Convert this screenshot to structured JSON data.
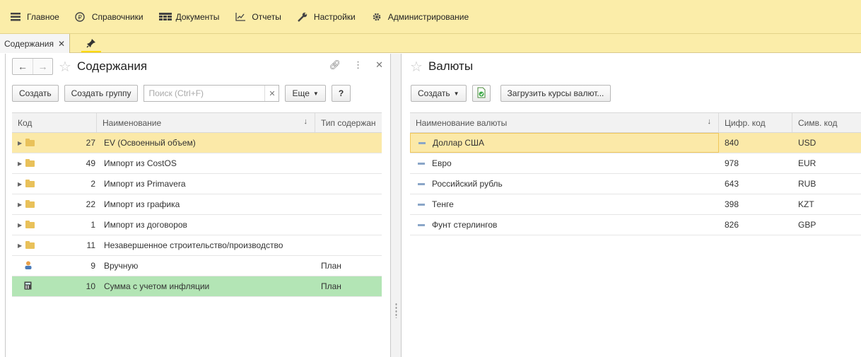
{
  "menu": [
    {
      "icon": "hamburger-icon",
      "label": "Главное"
    },
    {
      "icon": "ruble-icon",
      "label": "Справочники"
    },
    {
      "icon": "table-icon",
      "label": "Документы"
    },
    {
      "icon": "chart-icon",
      "label": "Отчеты"
    },
    {
      "icon": "wrench-icon",
      "label": "Настройки"
    },
    {
      "icon": "gear-icon",
      "label": "Администрирование"
    }
  ],
  "open_tab": {
    "label": "Содержания"
  },
  "left": {
    "title": "Содержания",
    "toolbar": {
      "create": "Создать",
      "create_group": "Создать группу",
      "search_placeholder": "Поиск (Ctrl+F)",
      "more": "Еще",
      "help": "?"
    },
    "columns": [
      "Код",
      "Наименование",
      "Тип содержан"
    ],
    "rows": [
      {
        "code": "27",
        "name": "EV (Освоенный объем)",
        "type": "",
        "kind": "folder"
      },
      {
        "code": "49",
        "name": "Импорт из CostOS",
        "type": "",
        "kind": "folder"
      },
      {
        "code": "2",
        "name": "Импорт из Primavera",
        "type": "",
        "kind": "folder"
      },
      {
        "code": "22",
        "name": "Импорт из графика",
        "type": "",
        "kind": "folder"
      },
      {
        "code": "1",
        "name": "Импорт из договоров",
        "type": "",
        "kind": "folder"
      },
      {
        "code": "11",
        "name": "Незавершенное строительство/производство",
        "type": "",
        "kind": "folder"
      },
      {
        "code": "9",
        "name": "Вручную",
        "type": "План",
        "kind": "user"
      },
      {
        "code": "10",
        "name": "Сумма с учетом инфляции",
        "type": "План",
        "kind": "calc"
      }
    ]
  },
  "right": {
    "title": "Валюты",
    "toolbar": {
      "create": "Создать",
      "load_rates": "Загрузить курсы валют..."
    },
    "columns": [
      "Наименование валюты",
      "Цифр. код",
      "Симв. код"
    ],
    "rows": [
      {
        "name": "Доллар США",
        "num": "840",
        "sym": "USD"
      },
      {
        "name": "Евро",
        "num": "978",
        "sym": "EUR"
      },
      {
        "name": "Российский рубль",
        "num": "643",
        "sym": "RUB"
      },
      {
        "name": "Тенге",
        "num": "398",
        "sym": "KZT"
      },
      {
        "name": "Фунт стерлингов",
        "num": "826",
        "sym": "GBP"
      }
    ]
  }
}
